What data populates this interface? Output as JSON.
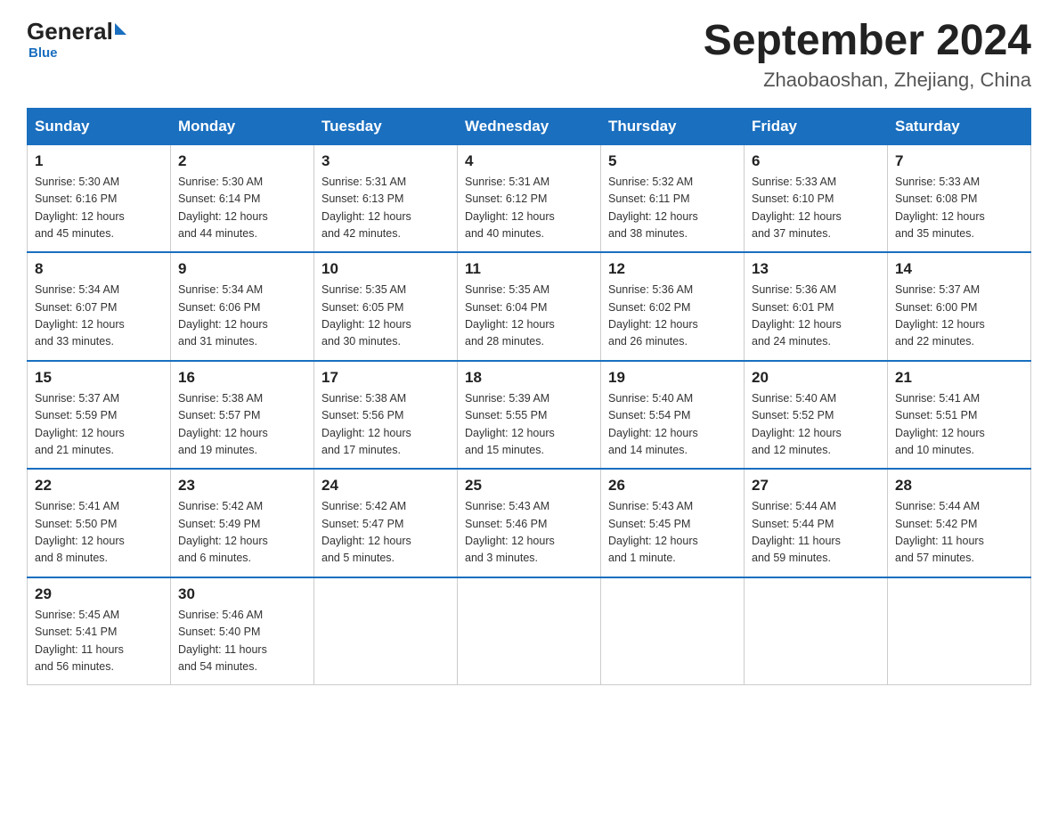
{
  "logo": {
    "text_general": "General",
    "triangle": "",
    "text_blue": "Blue",
    "subtitle": "Blue"
  },
  "header": {
    "title": "September 2024",
    "subtitle": "Zhaobaoshan, Zhejiang, China"
  },
  "days_of_week": [
    "Sunday",
    "Monday",
    "Tuesday",
    "Wednesday",
    "Thursday",
    "Friday",
    "Saturday"
  ],
  "weeks": [
    [
      {
        "day": "1",
        "sunrise": "5:30 AM",
        "sunset": "6:16 PM",
        "daylight": "12 hours and 45 minutes."
      },
      {
        "day": "2",
        "sunrise": "5:30 AM",
        "sunset": "6:14 PM",
        "daylight": "12 hours and 44 minutes."
      },
      {
        "day": "3",
        "sunrise": "5:31 AM",
        "sunset": "6:13 PM",
        "daylight": "12 hours and 42 minutes."
      },
      {
        "day": "4",
        "sunrise": "5:31 AM",
        "sunset": "6:12 PM",
        "daylight": "12 hours and 40 minutes."
      },
      {
        "day": "5",
        "sunrise": "5:32 AM",
        "sunset": "6:11 PM",
        "daylight": "12 hours and 38 minutes."
      },
      {
        "day": "6",
        "sunrise": "5:33 AM",
        "sunset": "6:10 PM",
        "daylight": "12 hours and 37 minutes."
      },
      {
        "day": "7",
        "sunrise": "5:33 AM",
        "sunset": "6:08 PM",
        "daylight": "12 hours and 35 minutes."
      }
    ],
    [
      {
        "day": "8",
        "sunrise": "5:34 AM",
        "sunset": "6:07 PM",
        "daylight": "12 hours and 33 minutes."
      },
      {
        "day": "9",
        "sunrise": "5:34 AM",
        "sunset": "6:06 PM",
        "daylight": "12 hours and 31 minutes."
      },
      {
        "day": "10",
        "sunrise": "5:35 AM",
        "sunset": "6:05 PM",
        "daylight": "12 hours and 30 minutes."
      },
      {
        "day": "11",
        "sunrise": "5:35 AM",
        "sunset": "6:04 PM",
        "daylight": "12 hours and 28 minutes."
      },
      {
        "day": "12",
        "sunrise": "5:36 AM",
        "sunset": "6:02 PM",
        "daylight": "12 hours and 26 minutes."
      },
      {
        "day": "13",
        "sunrise": "5:36 AM",
        "sunset": "6:01 PM",
        "daylight": "12 hours and 24 minutes."
      },
      {
        "day": "14",
        "sunrise": "5:37 AM",
        "sunset": "6:00 PM",
        "daylight": "12 hours and 22 minutes."
      }
    ],
    [
      {
        "day": "15",
        "sunrise": "5:37 AM",
        "sunset": "5:59 PM",
        "daylight": "12 hours and 21 minutes."
      },
      {
        "day": "16",
        "sunrise": "5:38 AM",
        "sunset": "5:57 PM",
        "daylight": "12 hours and 19 minutes."
      },
      {
        "day": "17",
        "sunrise": "5:38 AM",
        "sunset": "5:56 PM",
        "daylight": "12 hours and 17 minutes."
      },
      {
        "day": "18",
        "sunrise": "5:39 AM",
        "sunset": "5:55 PM",
        "daylight": "12 hours and 15 minutes."
      },
      {
        "day": "19",
        "sunrise": "5:40 AM",
        "sunset": "5:54 PM",
        "daylight": "12 hours and 14 minutes."
      },
      {
        "day": "20",
        "sunrise": "5:40 AM",
        "sunset": "5:52 PM",
        "daylight": "12 hours and 12 minutes."
      },
      {
        "day": "21",
        "sunrise": "5:41 AM",
        "sunset": "5:51 PM",
        "daylight": "12 hours and 10 minutes."
      }
    ],
    [
      {
        "day": "22",
        "sunrise": "5:41 AM",
        "sunset": "5:50 PM",
        "daylight": "12 hours and 8 minutes."
      },
      {
        "day": "23",
        "sunrise": "5:42 AM",
        "sunset": "5:49 PM",
        "daylight": "12 hours and 6 minutes."
      },
      {
        "day": "24",
        "sunrise": "5:42 AM",
        "sunset": "5:47 PM",
        "daylight": "12 hours and 5 minutes."
      },
      {
        "day": "25",
        "sunrise": "5:43 AM",
        "sunset": "5:46 PM",
        "daylight": "12 hours and 3 minutes."
      },
      {
        "day": "26",
        "sunrise": "5:43 AM",
        "sunset": "5:45 PM",
        "daylight": "12 hours and 1 minute."
      },
      {
        "day": "27",
        "sunrise": "5:44 AM",
        "sunset": "5:44 PM",
        "daylight": "11 hours and 59 minutes."
      },
      {
        "day": "28",
        "sunrise": "5:44 AM",
        "sunset": "5:42 PM",
        "daylight": "11 hours and 57 minutes."
      }
    ],
    [
      {
        "day": "29",
        "sunrise": "5:45 AM",
        "sunset": "5:41 PM",
        "daylight": "11 hours and 56 minutes."
      },
      {
        "day": "30",
        "sunrise": "5:46 AM",
        "sunset": "5:40 PM",
        "daylight": "11 hours and 54 minutes."
      },
      null,
      null,
      null,
      null,
      null
    ]
  ],
  "labels": {
    "sunrise": "Sunrise:",
    "sunset": "Sunset:",
    "daylight": "Daylight:"
  }
}
